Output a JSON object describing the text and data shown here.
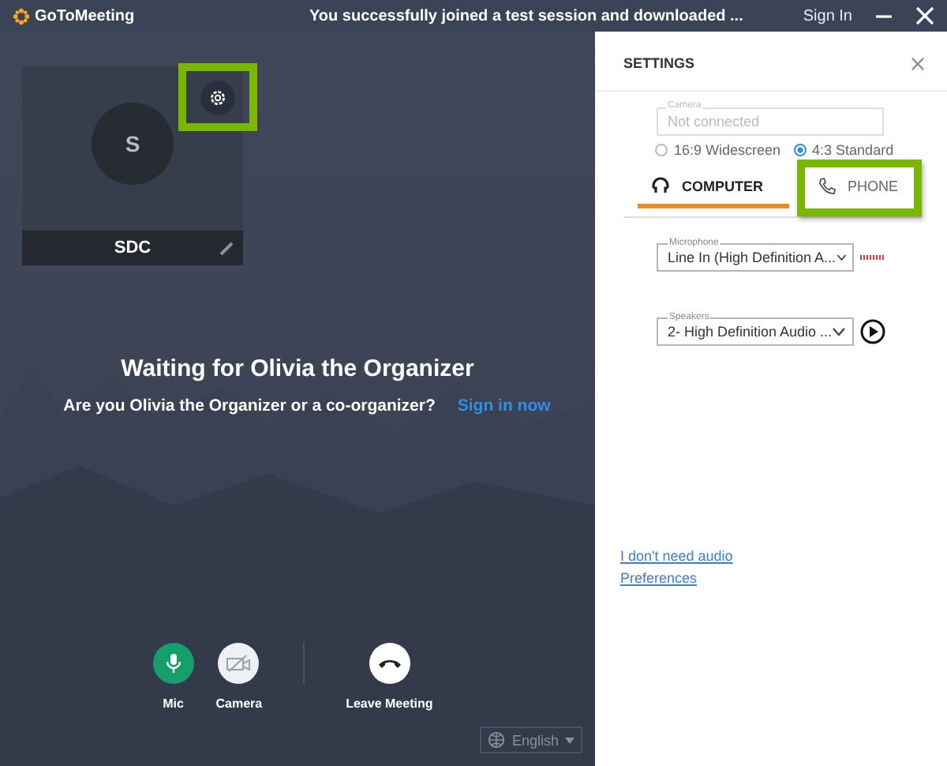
{
  "title_bar": {
    "logo": "GoToMeeting",
    "message": "You successfully joined a test session and downloaded ...",
    "sign_in": "Sign In"
  },
  "video_tile": {
    "initial": "S",
    "name": "SDC",
    "settings_highlighted": true
  },
  "waiting": {
    "heading": "Waiting for Olivia the Organizer",
    "question": "Are you Olivia the Organizer or a co-organizer?",
    "link": "Sign in now"
  },
  "controls": [
    {
      "kind": "mic",
      "label": "Mic"
    },
    {
      "kind": "camera",
      "label": "Camera"
    },
    {
      "kind": "leave",
      "label": "Leave Meeting"
    }
  ],
  "language": "English",
  "settings": {
    "title": "SETTINGS",
    "camera": {
      "label": "Camera",
      "placeholder": "Not connected"
    },
    "aspect": [
      {
        "label": "16:9 Widescreen",
        "selected": false
      },
      {
        "label": "4:3 Standard",
        "selected": true
      }
    ],
    "tabs": [
      {
        "kind": "computer",
        "label": "COMPUTER",
        "selected": true,
        "highlighted": false
      },
      {
        "kind": "phone",
        "label": "PHONE",
        "selected": false,
        "highlighted": true
      }
    ],
    "microphone": {
      "label": "Microphone",
      "value": "Line In (High Definition A..."
    },
    "speakers": {
      "label": "Speakers",
      "value": "2- High Definition Audio ..."
    },
    "links": [
      "I don't need audio",
      "Preferences"
    ]
  }
}
